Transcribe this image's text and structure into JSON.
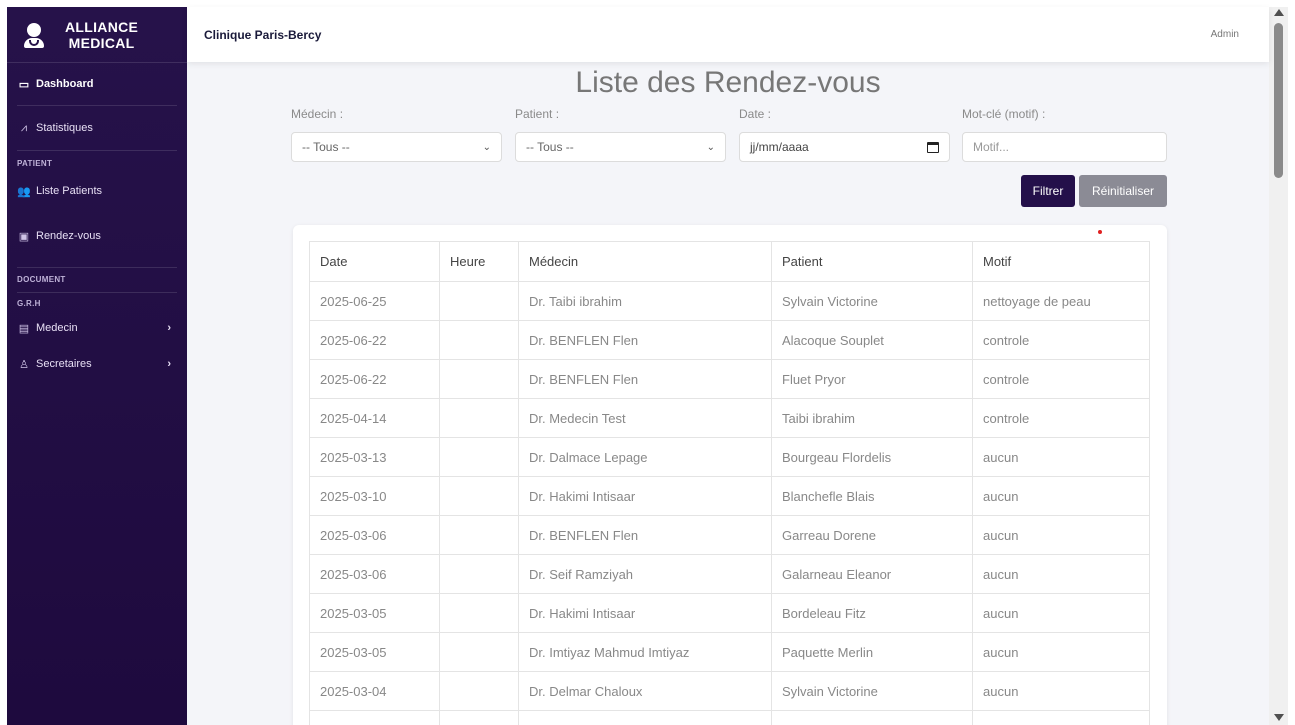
{
  "brand": {
    "line1": "ALLIANCE",
    "line2": "MEDICAL"
  },
  "sidebar": {
    "items": [
      {
        "label": "Dashboard",
        "icon": "monitor-icon"
      },
      {
        "label": "Statistiques",
        "icon": "chart-line-icon"
      },
      {
        "section": "PATIENT"
      },
      {
        "label": "Liste Patients",
        "icon": "users-icon"
      },
      {
        "label": "Rendez-vous",
        "icon": "calendar-check-icon"
      },
      {
        "section": "DOCUMENT"
      },
      {
        "section": "G.R.H"
      },
      {
        "label": "Medecin",
        "icon": "id-card-icon"
      },
      {
        "label": "Secretaires",
        "icon": "user-tie-icon"
      }
    ]
  },
  "topbar": {
    "clinic": "Clinique Paris-Bercy",
    "user": "Admin"
  },
  "page": {
    "title": "Liste des Rendez-vous"
  },
  "filters": {
    "medecin_label": "Médecin :",
    "medecin_value": "-- Tous --",
    "patient_label": "Patient :",
    "patient_value": "-- Tous --",
    "date_label": "Date :",
    "date_placeholder": "jj/mm/aaaa",
    "motif_label": "Mot-clé (motif) :",
    "motif_placeholder": "Motif...",
    "filter_button": "Filtrer",
    "reset_button": "Réinitialiser"
  },
  "table": {
    "headers": [
      "Date",
      "Heure",
      "Médecin",
      "Patient",
      "Motif"
    ],
    "rows": [
      [
        "2025-06-25",
        "",
        "Dr. Taibi ibrahim",
        "Sylvain Victorine",
        "nettoyage de peau"
      ],
      [
        "2025-06-22",
        "",
        "Dr. BENFLEN Flen",
        "Alacoque Souplet",
        "controle"
      ],
      [
        "2025-06-22",
        "",
        "Dr. BENFLEN Flen",
        "Fluet Pryor",
        "controle"
      ],
      [
        "2025-04-14",
        "",
        "Dr. Medecin Test",
        "Taibi ibrahim",
        "controle"
      ],
      [
        "2025-03-13",
        "",
        "Dr. Dalmace Lepage",
        "Bourgeau Flordelis",
        "aucun"
      ],
      [
        "2025-03-10",
        "",
        "Dr. Hakimi Intisaar",
        "Blanchefle Blais",
        "aucun"
      ],
      [
        "2025-03-06",
        "",
        "Dr. BENFLEN Flen",
        "Garreau Dorene",
        "aucun"
      ],
      [
        "2025-03-06",
        "",
        "Dr. Seif Ramziyah",
        "Galarneau Eleanor",
        "aucun"
      ],
      [
        "2025-03-05",
        "",
        "Dr. Hakimi Intisaar",
        "Bordeleau Fitz",
        "aucun"
      ],
      [
        "2025-03-05",
        "",
        "Dr. Imtiyaz Mahmud Imtiyaz",
        "Paquette Merlin",
        "aucun"
      ],
      [
        "2025-03-04",
        "",
        "Dr. Delmar Chaloux",
        "Sylvain Victorine",
        "aucun"
      ],
      [
        "",
        "",
        "",
        "",
        ""
      ]
    ]
  },
  "colors": {
    "sidebar": "#26124a",
    "primary": "#24104a",
    "secondary": "#8b8b95"
  }
}
